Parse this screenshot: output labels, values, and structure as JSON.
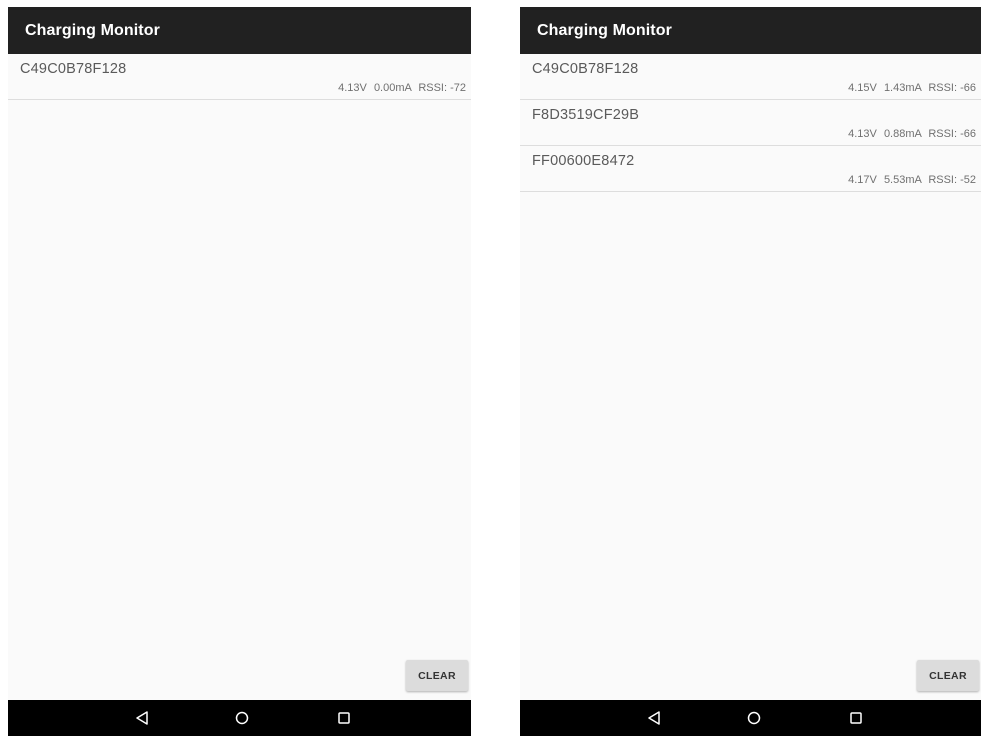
{
  "screens": [
    {
      "app_bar": {
        "title": "Charging Monitor"
      },
      "devices": [
        {
          "name": "C49C0B78F128",
          "voltage": "4.13V",
          "current": "0.00mA",
          "rssi": "RSSI: -72"
        }
      ],
      "clear_label": "CLEAR",
      "nav": [
        "back-icon",
        "home-icon",
        "recents-icon"
      ]
    },
    {
      "app_bar": {
        "title": "Charging Monitor"
      },
      "devices": [
        {
          "name": "C49C0B78F128",
          "voltage": "4.15V",
          "current": "1.43mA",
          "rssi": "RSSI: -66"
        },
        {
          "name": "F8D3519CF29B",
          "voltage": "4.13V",
          "current": "0.88mA",
          "rssi": "RSSI: -66"
        },
        {
          "name": "FF00600E8472",
          "voltage": "4.17V",
          "current": "5.53mA",
          "rssi": "RSSI: -52"
        }
      ],
      "clear_label": "CLEAR",
      "nav": [
        "back-icon",
        "home-icon",
        "recents-icon"
      ]
    }
  ],
  "colors": {
    "app_bar": "#212121",
    "background": "#fafafa",
    "nav_bar": "#000000",
    "button": "#dcdcdc"
  }
}
